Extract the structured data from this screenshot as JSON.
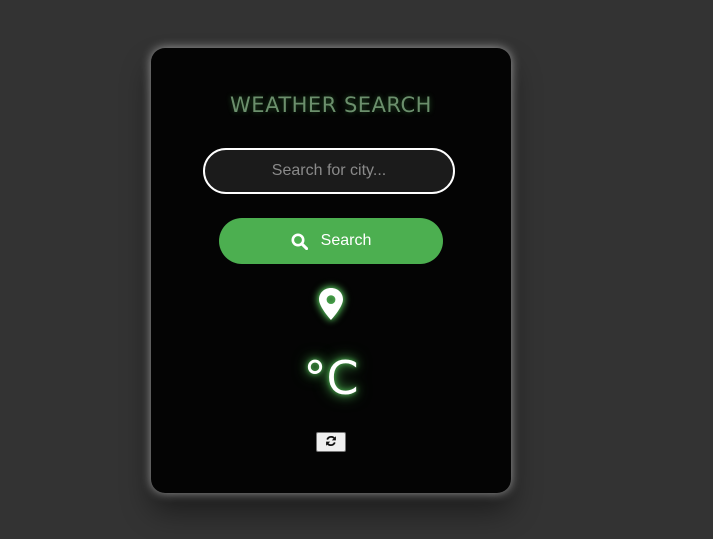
{
  "app": {
    "title": "WEATHER SEARCH"
  },
  "search": {
    "placeholder": "Search for city...",
    "value": "",
    "button_label": "Search",
    "button_icon": "search-icon"
  },
  "location": {
    "icon": "location-pin-icon",
    "name": ""
  },
  "temperature": {
    "value": "",
    "unit": "°C"
  },
  "refresh": {
    "icon": "refresh-icon"
  },
  "colors": {
    "background": "#333333",
    "card": "#040404",
    "accent": "#4caf50",
    "title": "#6b8f6c"
  }
}
